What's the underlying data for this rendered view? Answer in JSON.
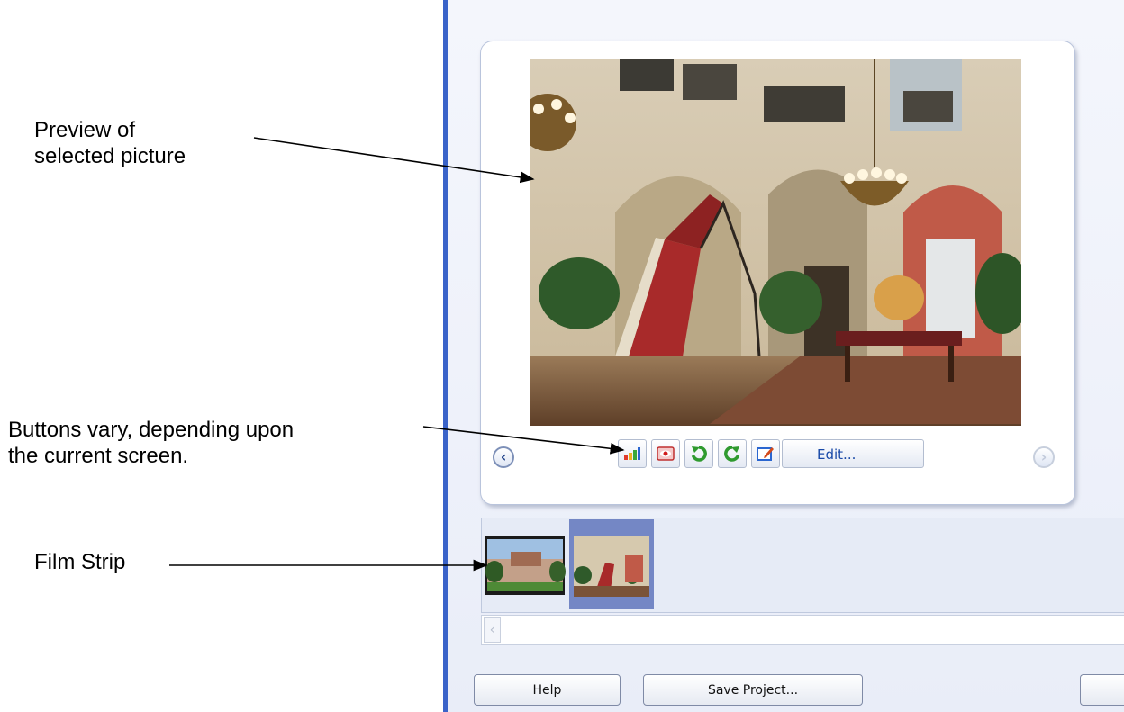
{
  "annotations": {
    "preview": [
      "Preview of",
      "selected picture"
    ],
    "buttons": [
      "Buttons vary, depending upon",
      "the current screen."
    ],
    "filmstrip": [
      "Film Strip"
    ]
  },
  "preview_toolbar": {
    "prev_icon": "chevron-left-icon",
    "next_icon": "chevron-right-icon",
    "tools": [
      "auto-adjust-icon",
      "red-eye-icon",
      "rotate-left-icon",
      "rotate-right-icon"
    ],
    "edit_label": "Edit..."
  },
  "filmstrip": {
    "thumbnails": [
      {
        "subject": "mansion exterior",
        "selected": false
      },
      {
        "subject": "grand hall interior",
        "selected": true
      }
    ]
  },
  "footer": {
    "help_label": "Help",
    "save_label": "Save Project..."
  },
  "colors": {
    "window_edge": "#3a63c9",
    "selection": "#7487c5",
    "link_text": "#1a4aa8"
  }
}
